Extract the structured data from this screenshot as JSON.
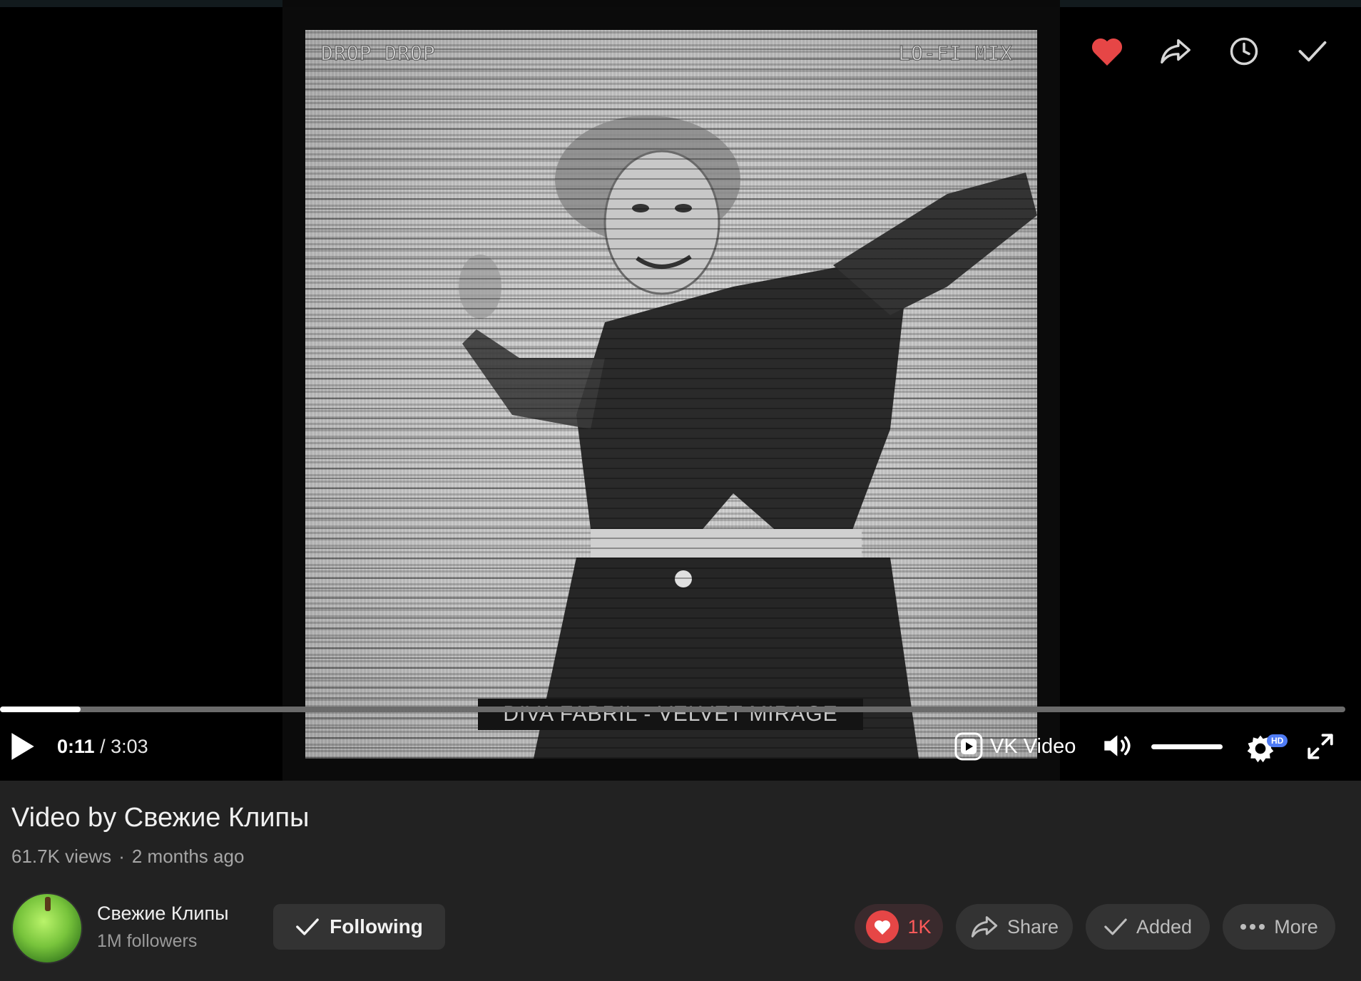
{
  "player": {
    "overlay_top_left": "DROP DROP",
    "overlay_top_right": "LO-FI MIX",
    "caption": "DIVA FABRIL - VELVET MIRAGE",
    "current_time": "0:11",
    "separator": "/",
    "duration": "3:03",
    "progress_fraction": 0.06,
    "brand": "VK Video",
    "hd": "HD",
    "volume_fraction": 1.0,
    "liked": true,
    "colors": {
      "accent_red": "#e64646",
      "hd_blue": "#4f7cf5"
    }
  },
  "video": {
    "title": "Video by Свежие Клипы",
    "views": "61.7K views",
    "dot": "·",
    "age": "2 months ago"
  },
  "channel": {
    "name": "Свежие Клипы",
    "followers": "1M followers",
    "follow_label": "Following"
  },
  "actions": {
    "like_count": "1K",
    "share_label": "Share",
    "added_label": "Added",
    "more_label": "More"
  },
  "icons": [
    "heart-icon",
    "share-arrow-icon",
    "clock-icon",
    "check-icon",
    "play-icon",
    "vk-logo-icon",
    "volume-icon",
    "settings-gear-icon",
    "fullscreen-icon",
    "ellipsis-icon"
  ]
}
